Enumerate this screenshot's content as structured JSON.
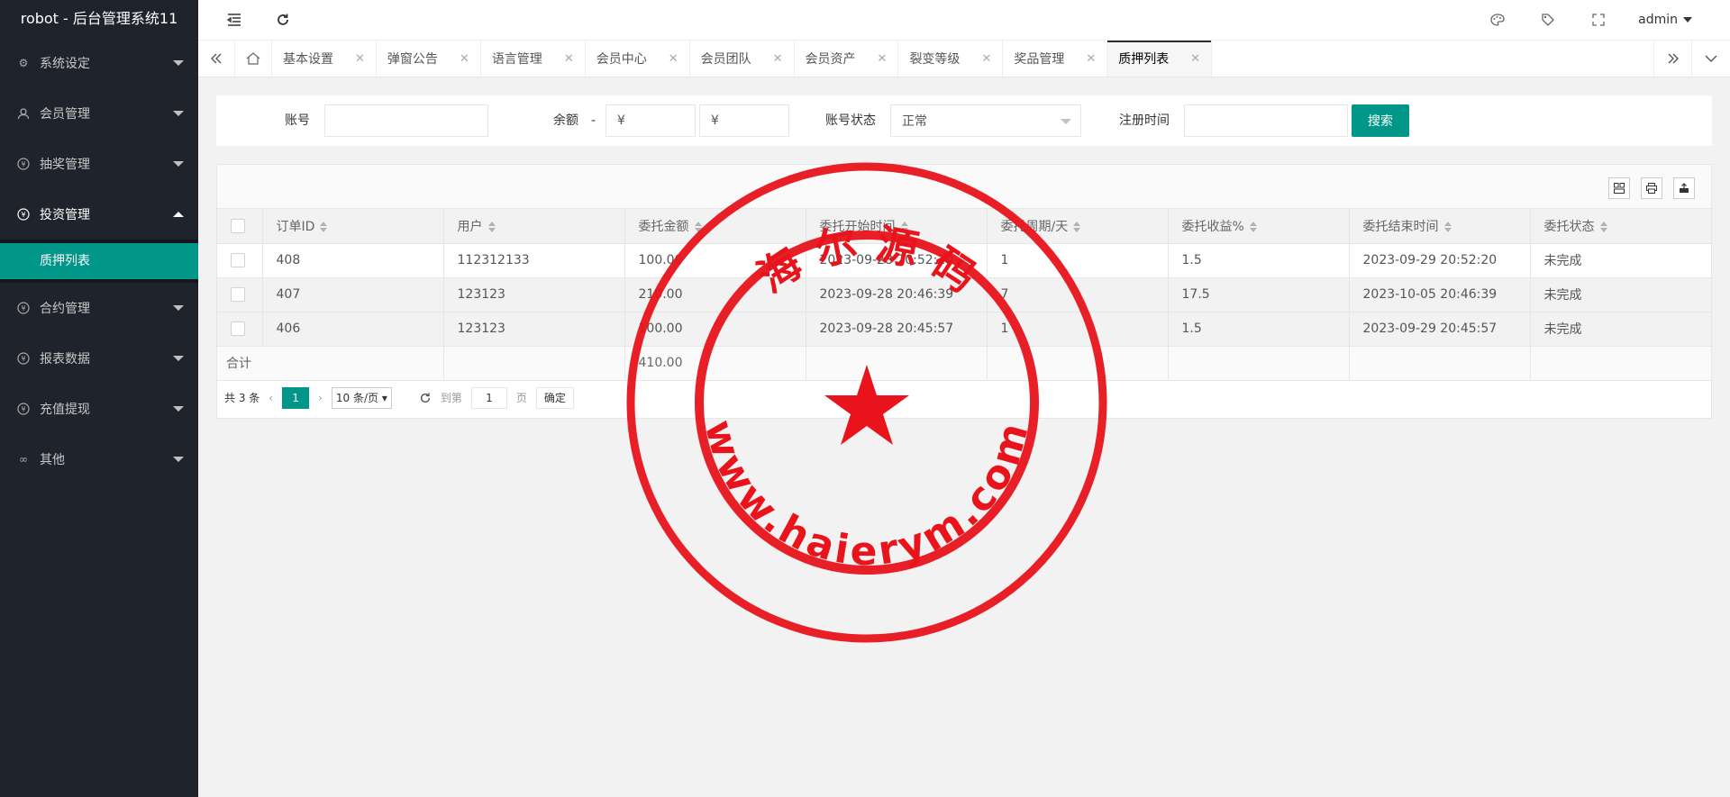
{
  "app": {
    "title": "robot - 后台管理系统11"
  },
  "sidebar": {
    "items": [
      {
        "label": "系统设定",
        "icon": "gear-icon"
      },
      {
        "label": "会员管理",
        "icon": "user-icon"
      },
      {
        "label": "抽奖管理",
        "icon": "yen-icon"
      },
      {
        "label": "投资管理",
        "icon": "yen-icon",
        "open": true
      },
      {
        "label": "合约管理",
        "icon": "yen-icon"
      },
      {
        "label": "报表数据",
        "icon": "yen-icon"
      },
      {
        "label": "充值提现",
        "icon": "yen-icon"
      },
      {
        "label": "其他",
        "icon": "infinity-icon"
      }
    ],
    "submenu": {
      "label": "质押列表"
    }
  },
  "header": {
    "user": "admin"
  },
  "tabs": [
    {
      "label": "基本设置"
    },
    {
      "label": "弹窗公告"
    },
    {
      "label": "语言管理"
    },
    {
      "label": "会员中心"
    },
    {
      "label": "会员团队"
    },
    {
      "label": "会员资产"
    },
    {
      "label": "裂变等级"
    },
    {
      "label": "奖品管理"
    },
    {
      "label": "质押列表",
      "active": true
    }
  ],
  "search": {
    "account_label": "账号",
    "balance_label": "余额",
    "balance_sep": "-",
    "balance_min_placeholder": "¥",
    "balance_max_placeholder": "¥",
    "status_label": "账号状态",
    "status_value": "正常",
    "regtime_label": "注册时间",
    "search_button": "搜索"
  },
  "table": {
    "columns": [
      "订单ID",
      "用户",
      "委托金额",
      "委托开始时间",
      "委托周期/天",
      "委托收益%",
      "委托结束时间",
      "委托状态"
    ],
    "rows": [
      [
        "408",
        "112312133",
        "100.00",
        "2023-09-28 20:52:20",
        "1",
        "1.5",
        "2023-09-29 20:52:20",
        "未完成"
      ],
      [
        "407",
        "123123",
        "210.00",
        "2023-09-28 20:46:39",
        "7",
        "17.5",
        "2023-10-05 20:46:39",
        "未完成"
      ],
      [
        "406",
        "123123",
        "100.00",
        "2023-09-28 20:45:57",
        "1",
        "1.5",
        "2023-09-29 20:45:57",
        "未完成"
      ]
    ],
    "total_label": "合计",
    "total_amount": "410.00"
  },
  "pager": {
    "total": "共 3 条",
    "current": "1",
    "page_size": "10 条/页",
    "goto_label": "到第",
    "goto_value": "1",
    "page_unit": "页",
    "confirm": "确定"
  },
  "watermark": {
    "top_text": "海 尔 源 码",
    "bottom_text": "www.haierym.com",
    "color": "#e8131b"
  }
}
